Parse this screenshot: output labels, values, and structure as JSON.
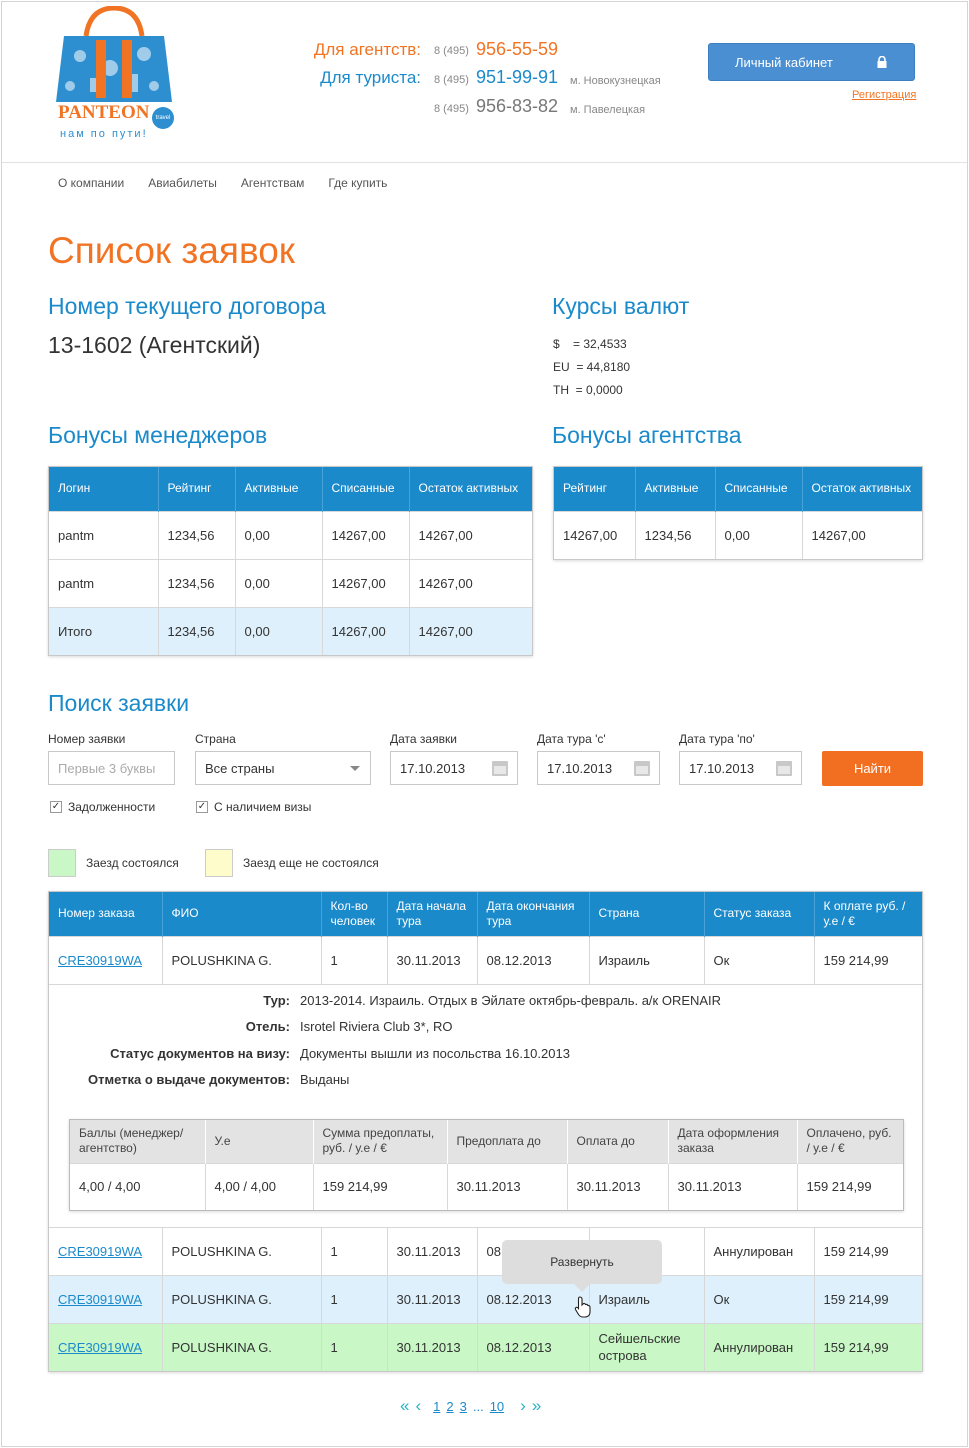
{
  "header": {
    "logo_text": "PANTEON",
    "logo_badge": "travel",
    "logo_slogan": "нам по пути!",
    "phones": [
      {
        "label": "Для агентств:",
        "prefix": "8 (495)",
        "number": "956-55-59",
        "metro": ""
      },
      {
        "label": "Для туриста:",
        "prefix": "8 (495)",
        "number": "951-99-91",
        "metro": "м. Новокузнецкая"
      },
      {
        "label": "",
        "prefix": "8 (495)",
        "number": "956-83-82",
        "metro": "м. Павелецкая"
      }
    ],
    "cabinet_button": "Личный кабинет",
    "register_link": "Регистрация"
  },
  "nav": [
    "О компании",
    "Авиабилеты",
    "Агентствам",
    "Где купить"
  ],
  "page_title": "Список заявок",
  "contract": {
    "title": "Номер текущего договора",
    "value": "13-1602 (Агентский)"
  },
  "rates": {
    "title": "Курсы валют",
    "items": [
      "$    = 32,4533",
      "EU  = 44,8180",
      "TH  = 0,0000"
    ]
  },
  "managers_bonus": {
    "title": "Бонусы менеджеров",
    "headers": [
      "Логин",
      "Рейтинг",
      "Активные",
      "Списанные",
      "Остаток активных"
    ],
    "rows": [
      [
        "pantm",
        "1234,56",
        "0,00",
        "14267,00",
        "14267,00"
      ],
      [
        "pantm",
        "1234,56",
        "0,00",
        "14267,00",
        "14267,00"
      ]
    ],
    "total": [
      "Итого",
      "1234,56",
      "0,00",
      "14267,00",
      "14267,00"
    ]
  },
  "agency_bonus": {
    "title": "Бонусы агентства",
    "headers": [
      "Рейтинг",
      "Активные",
      "Списанные",
      "Остаток активных"
    ],
    "row": [
      "14267,00",
      "1234,56",
      "0,00",
      "14267,00"
    ]
  },
  "search": {
    "title": "Поиск заявки",
    "order_label": "Номер заявки",
    "order_placeholder": "Первые 3 буквы",
    "country_label": "Страна",
    "country_value": "Все страны",
    "date_label": "Дата заявки",
    "date_value": "17.10.2013",
    "tour_from_label": "Дата тура 'с'",
    "tour_from_value": "17.10.2013",
    "tour_to_label": "Дата тура 'по'",
    "tour_to_value": "17.10.2013",
    "find_button": "Найти",
    "check_debts": "Задолженности",
    "check_visa": "С наличием визы"
  },
  "legend": {
    "done": "Заезд состоялся",
    "pending": "Заезд еще не состоялся",
    "done_color": "#c9f7c6",
    "pending_color": "#fffccc"
  },
  "orders": {
    "headers": [
      "Номер заказа",
      "ФИО",
      "Кол-во человек",
      "Дата начала тура",
      "Дата окончания тура",
      "Страна",
      "Статус заказа",
      "К оплате руб. / у.е / €"
    ],
    "rows": [
      [
        "CRE30919WA",
        "POLUSHKINA G.",
        "1",
        "30.11.2013",
        "08.12.2013",
        "Израиль",
        "Ок",
        "159 214,99"
      ],
      [
        "CRE30919WA",
        "POLUSHKINA G.",
        "1",
        "30.11.2013",
        "08",
        "",
        "Аннулирован",
        "159 214,99"
      ],
      [
        "CRE30919WA",
        "POLUSHKINA G.",
        "1",
        "30.11.2013",
        "08.12.2013",
        "Израиль",
        "Ок",
        "159 214,99"
      ],
      [
        "CRE30919WA",
        "POLUSHKINA G.",
        "1",
        "30.11.2013",
        "08.12.2013",
        "Сейшельские острова",
        "Аннулирован",
        "159 214,99"
      ]
    ],
    "detail": {
      "tour_label": "Тур:",
      "tour_value": "2013-2014. Израиль. Отдых в Эйлате октябрь-февраль. а/к ORENAIR",
      "hotel_label": "Отель:",
      "hotel_value": "Isrotel Riviera Club 3*, RO",
      "visa_label": "Статус документов на визу:",
      "visa_value": "Документы вышли из посольства 16.10.2013",
      "issue_label": "Отметка о выдаче документов:",
      "issue_value": "Выданы",
      "sub_headers": [
        "Баллы (менеджер/ агентство)",
        "У.е",
        "Сумма предоплаты, руб. / у.е / €",
        "Предоплата до",
        "Оплата до",
        "Дата оформления заказа",
        "Оплачено, руб. / у.е / €"
      ],
      "sub_row": [
        "4,00 / 4,00",
        "4,00 / 4,00",
        "159 214,99",
        "30.11.2013",
        "30.11.2013",
        "30.11.2013",
        "159 214,99"
      ]
    },
    "tooltip": "Развернуть"
  },
  "pager": {
    "pages": [
      "1",
      "2",
      "3"
    ],
    "ellipsis": "...",
    "last": "10"
  }
}
